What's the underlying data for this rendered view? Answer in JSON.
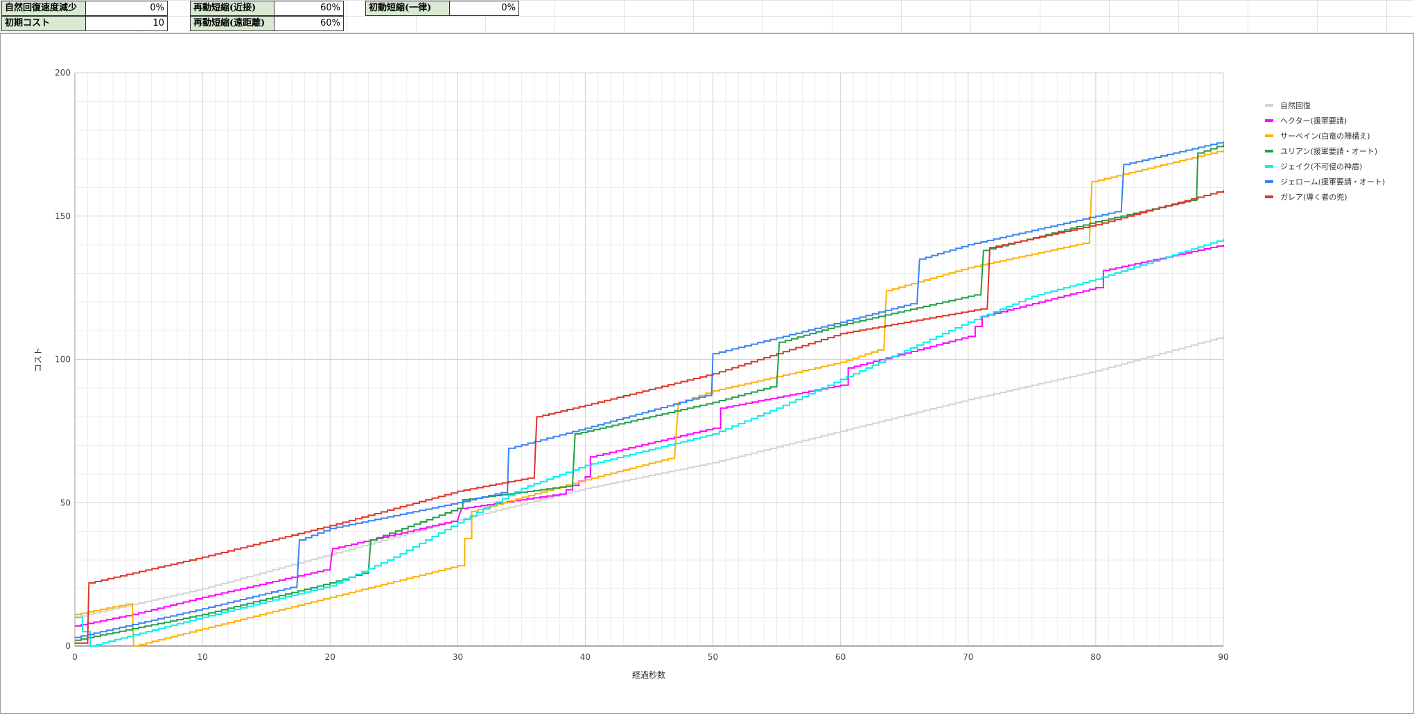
{
  "params": [
    {
      "label": "自然回復速度減少",
      "value": "0%"
    },
    {
      "label": "初期コスト",
      "value": "10"
    },
    {
      "label": "再動短縮(近接)",
      "value": "60%"
    },
    {
      "label": "再動短縮(遠距離)",
      "value": "60%"
    },
    {
      "label": "初動短縮(一律)",
      "value": "0%"
    }
  ],
  "chart_data": {
    "type": "line",
    "step": true,
    "title": "",
    "xlabel": "経過秒数",
    "ylabel": "コスト",
    "xlim": [
      0,
      90
    ],
    "ylim": [
      0,
      200
    ],
    "xticks": [
      0,
      10,
      20,
      30,
      40,
      50,
      60,
      70,
      80,
      90
    ],
    "yticks": [
      0,
      50,
      100,
      150,
      200
    ],
    "grid": true,
    "legend_position": "right",
    "series": [
      {
        "name": "自然回復",
        "color": "#d3d3d3",
        "points": [
          [
            0,
            10
          ],
          [
            10,
            20
          ],
          [
            20,
            32
          ],
          [
            30,
            44
          ],
          [
            40,
            55
          ],
          [
            50,
            64
          ],
          [
            60,
            75
          ],
          [
            70,
            86
          ],
          [
            80,
            96
          ],
          [
            90,
            108
          ]
        ]
      },
      {
        "name": "ヘクター(援軍要請)",
        "color": "#ff00ff",
        "points": [
          [
            0,
            7
          ],
          [
            4.5,
            11
          ],
          [
            10,
            17
          ],
          [
            20,
            27
          ],
          [
            20.2,
            34
          ],
          [
            30,
            44
          ],
          [
            30.3,
            48
          ],
          [
            38,
            53
          ],
          [
            40,
            59
          ],
          [
            40.4,
            66
          ],
          [
            50,
            76
          ],
          [
            50.6,
            83
          ],
          [
            60,
            91
          ],
          [
            60.6,
            97
          ],
          [
            70,
            108
          ],
          [
            71.1,
            115
          ],
          [
            80,
            125
          ],
          [
            80.6,
            131
          ],
          [
            90,
            140
          ]
        ]
      },
      {
        "name": "サーベイン(白竜の陣構え)",
        "color": "#ffb000",
        "points": [
          [
            0,
            11
          ],
          [
            4.5,
            15
          ],
          [
            4.6,
            0
          ],
          [
            10,
            6
          ],
          [
            20,
            17
          ],
          [
            30,
            28
          ],
          [
            31.1,
            47
          ],
          [
            40,
            58
          ],
          [
            47,
            66
          ],
          [
            47.3,
            85
          ],
          [
            50,
            89
          ],
          [
            60,
            99
          ],
          [
            63.4,
            104
          ],
          [
            63.6,
            124
          ],
          [
            70,
            132
          ],
          [
            79.5,
            141
          ],
          [
            79.7,
            162
          ],
          [
            90,
            173
          ]
        ]
      },
      {
        "name": "ユリアン(援軍要請・オート)",
        "color": "#22a045",
        "points": [
          [
            0,
            2
          ],
          [
            10,
            11
          ],
          [
            20,
            22
          ],
          [
            23,
            26
          ],
          [
            23.2,
            37
          ],
          [
            30,
            48
          ],
          [
            30.4,
            51
          ],
          [
            39,
            56
          ],
          [
            39.2,
            74
          ],
          [
            47,
            82
          ],
          [
            50,
            85
          ],
          [
            55,
            91
          ],
          [
            55.2,
            106
          ],
          [
            60,
            112
          ],
          [
            71,
            123
          ],
          [
            71.2,
            138
          ],
          [
            80,
            148
          ],
          [
            87.9,
            156
          ],
          [
            88,
            172
          ],
          [
            90,
            175
          ]
        ]
      },
      {
        "name": "ジェイク(不可侵の神盾)",
        "color": "#00eeee",
        "points": [
          [
            0,
            10
          ],
          [
            1.2,
            0
          ],
          [
            10,
            10
          ],
          [
            20,
            21
          ],
          [
            25,
            31
          ],
          [
            30,
            43
          ],
          [
            35,
            55
          ],
          [
            40,
            63
          ],
          [
            50,
            74
          ],
          [
            55,
            83
          ],
          [
            60,
            93
          ],
          [
            70,
            113
          ],
          [
            75,
            122
          ],
          [
            80,
            128
          ],
          [
            90,
            142
          ]
        ]
      },
      {
        "name": "ジェローム(援軍要請・オート)",
        "color": "#3b82f6",
        "points": [
          [
            0,
            3
          ],
          [
            10,
            13
          ],
          [
            17.4,
            21
          ],
          [
            17.6,
            37
          ],
          [
            20,
            41
          ],
          [
            30,
            50
          ],
          [
            33.9,
            54
          ],
          [
            34,
            69
          ],
          [
            40,
            76
          ],
          [
            49.9,
            88
          ],
          [
            50,
            102
          ],
          [
            60,
            113
          ],
          [
            66,
            120
          ],
          [
            66.2,
            135
          ],
          [
            70,
            140
          ],
          [
            82,
            152
          ],
          [
            82.2,
            168
          ],
          [
            90,
            176
          ]
        ]
      },
      {
        "name": "ガレア(導く者の兜)",
        "color": "#e0332a",
        "points": [
          [
            0,
            1
          ],
          [
            1,
            1
          ],
          [
            1.1,
            22
          ],
          [
            10,
            31
          ],
          [
            20,
            42
          ],
          [
            30,
            54
          ],
          [
            36,
            59
          ],
          [
            36.2,
            80
          ],
          [
            40,
            84
          ],
          [
            50,
            95
          ],
          [
            60,
            109
          ],
          [
            71.5,
            118
          ],
          [
            71.7,
            139
          ],
          [
            80,
            147
          ],
          [
            90,
            159
          ]
        ]
      }
    ]
  }
}
